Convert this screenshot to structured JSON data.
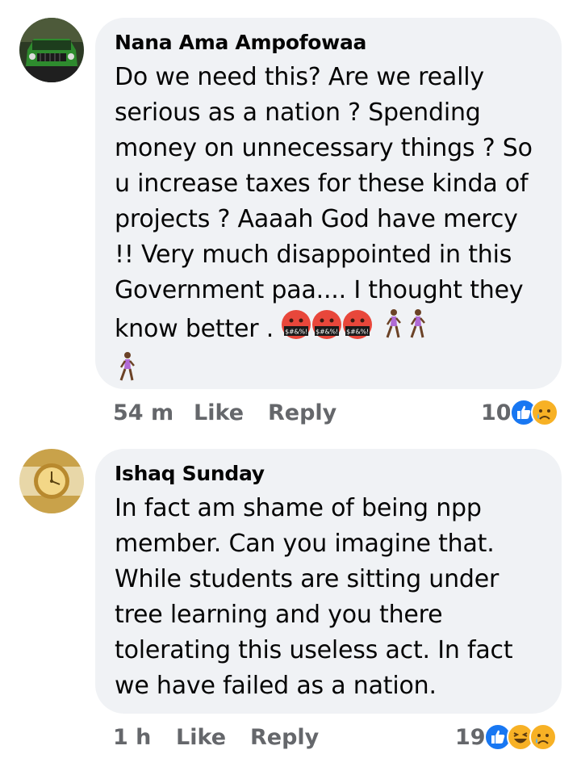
{
  "comments": [
    {
      "author": "Nana Ama Ampofowaa",
      "text": "Do we need this? Are we really serious as a nation ? Spending money on unnecessary things ? So u increase taxes for these kinda of projects ? Aaaah God have mercy !! Very much disappointed in this Government paa.... I thought they know better .",
      "emojis": [
        "face-with-symbols-on-mouth",
        "face-with-symbols-on-mouth",
        "face-with-symbols-on-mouth",
        "person-walking",
        "person-walking",
        "person-walking"
      ],
      "time": "54 m",
      "like_label": "Like",
      "reply_label": "Reply",
      "reaction_count": "10",
      "reactions": [
        "like-icon",
        "sad-icon"
      ],
      "avatar_icon": "green-car-avatar"
    },
    {
      "author": "Ishaq Sunday",
      "text": "In fact am shame of being npp member. Can you imagine that. While students are sitting under tree learning and you there tolerating this useless act. In fact we have failed as a nation.",
      "time": "1 h",
      "like_label": "Like",
      "reply_label": "Reply",
      "reaction_count": "19",
      "reactions": [
        "like-icon",
        "haha-icon",
        "sad-icon"
      ],
      "avatar_icon": "gold-watch-avatar"
    }
  ],
  "colors": {
    "bubble": "#f0f2f5",
    "meta_text": "#65676b",
    "like_blue": "#1877f2",
    "emoji_yellow": "#f7b125"
  }
}
